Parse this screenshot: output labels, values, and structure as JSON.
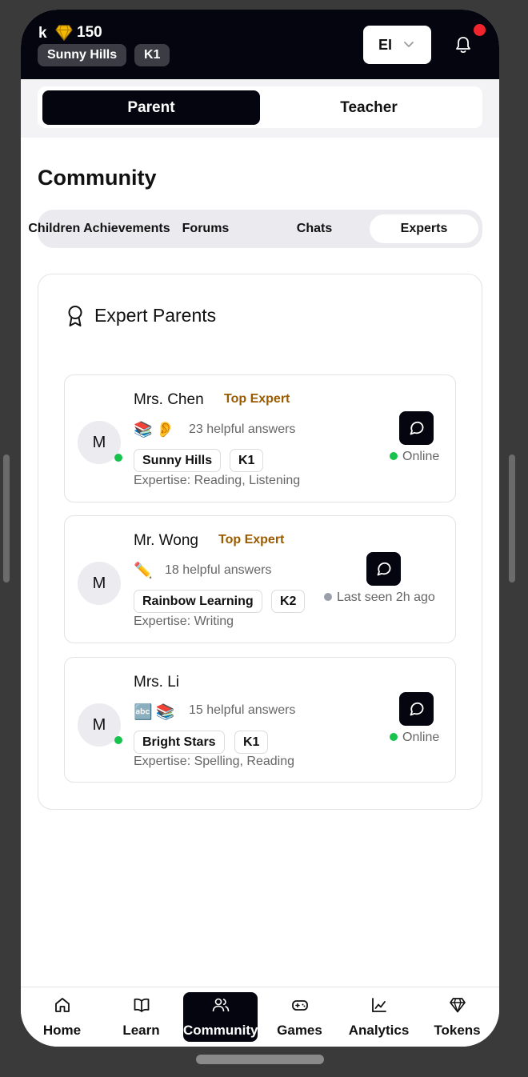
{
  "header": {
    "user_initial": "k",
    "tokens": "150",
    "school": "Sunny Hills",
    "grade": "K1",
    "language": "EI"
  },
  "role_toggle": {
    "parent": "Parent",
    "teacher": "Teacher",
    "selected": "Parent"
  },
  "page_title": "Community",
  "tabs": [
    {
      "label": "Children Achievements"
    },
    {
      "label": "Forums"
    },
    {
      "label": "Chats"
    },
    {
      "label": "Experts",
      "active": true
    }
  ],
  "experts_section": {
    "title": "Expert Parents",
    "experts": [
      {
        "avatar": "M",
        "name": "Mrs. Chen",
        "badge": "Top Expert",
        "emojis": "📚👂",
        "answers": "23 helpful answers",
        "school": "Sunny Hills",
        "grade": "K1",
        "expertise": "Expertise: Reading, Listening",
        "status": "Online",
        "online": true
      },
      {
        "avatar": "M",
        "name": "Mr. Wong",
        "badge": "Top Expert",
        "emojis": "✏️",
        "answers": "18 helpful answers",
        "school": "Rainbow Learning",
        "grade": "K2",
        "expertise": "Expertise: Writing",
        "status": "Last seen 2h ago",
        "online": false
      },
      {
        "avatar": "M",
        "name": "Mrs. Li",
        "badge": "",
        "emojis": "🔤📚",
        "answers": "15 helpful answers",
        "school": "Bright Stars",
        "grade": "K1",
        "expertise": "Expertise: Spelling, Reading",
        "status": "Online",
        "online": true
      }
    ]
  },
  "bottom_nav": [
    {
      "label": "Home",
      "icon": "home-icon"
    },
    {
      "label": "Learn",
      "icon": "book-icon"
    },
    {
      "label": "Community",
      "icon": "users-icon",
      "active": true
    },
    {
      "label": "Games",
      "icon": "gamepad-icon"
    },
    {
      "label": "Analytics",
      "icon": "chart-icon"
    },
    {
      "label": "Tokens",
      "icon": "gem-icon"
    }
  ],
  "colors": {
    "header_bg": "#05050f",
    "badge_text": "#9a5b00",
    "online_dot": "#17c24d",
    "offline_dot": "#9aa0aa",
    "notification_dot": "#f0242c",
    "gem": "#f5b800"
  }
}
